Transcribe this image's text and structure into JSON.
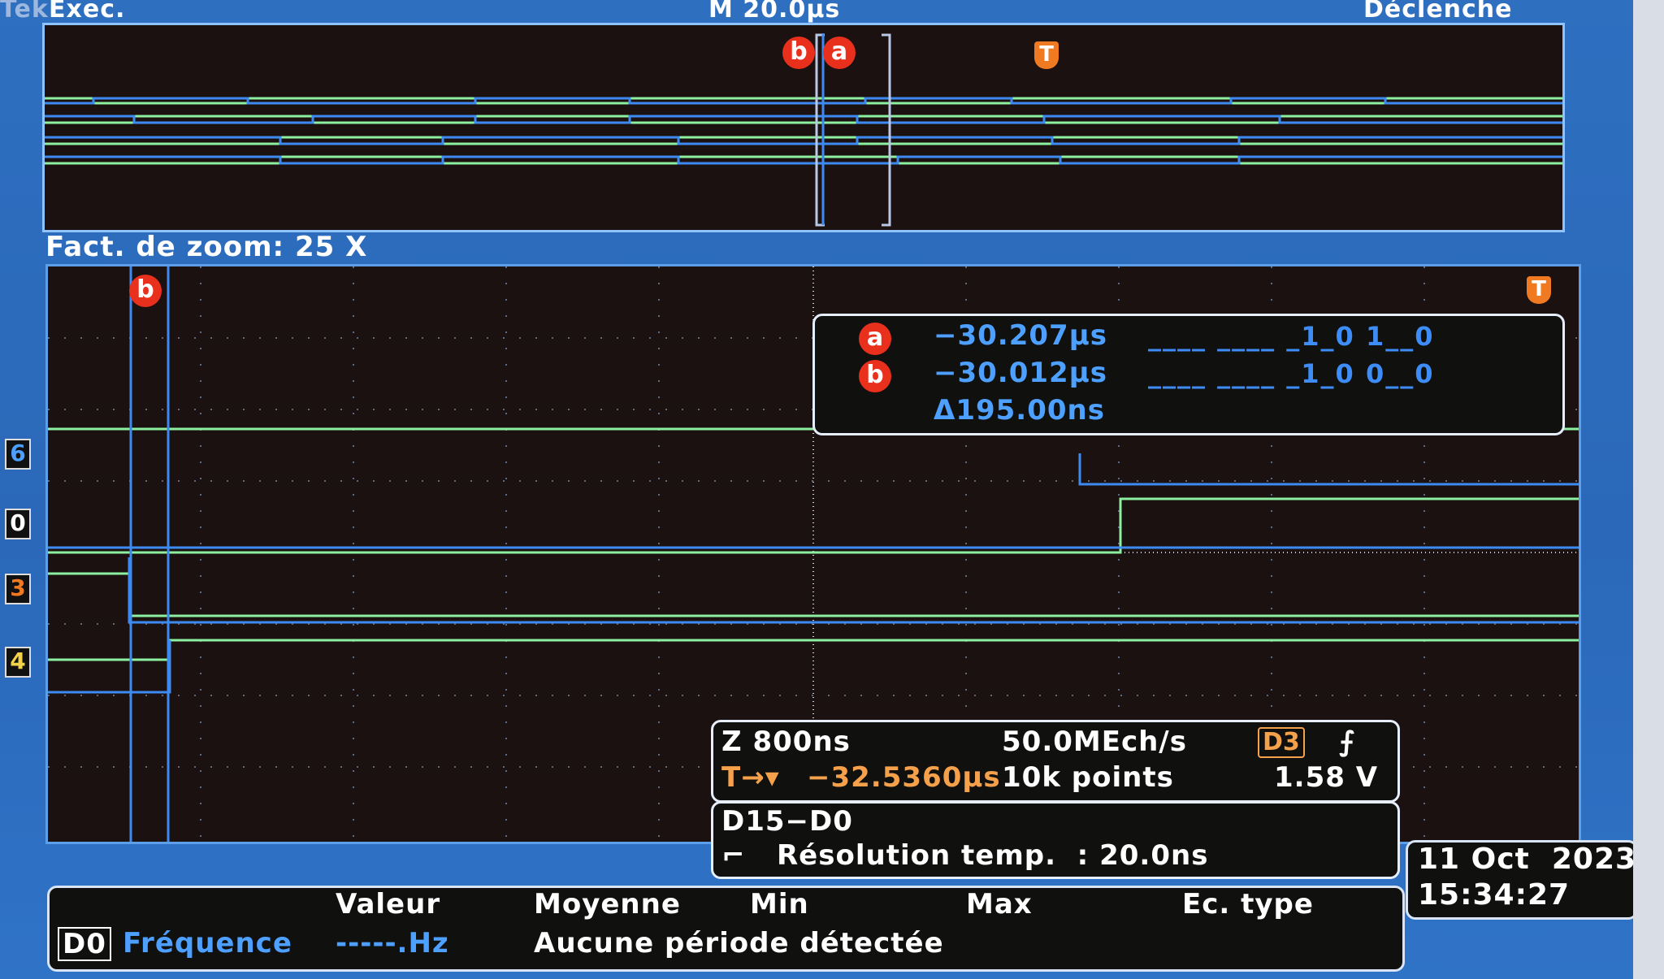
{
  "header": {
    "run_status": "Exec.",
    "timebase": "M 20.0µs",
    "trigger_mode": "Déclenche",
    "brand_fragment": "Tek"
  },
  "overview": {
    "markers": {
      "a": "a",
      "b": "b",
      "trigger": "T"
    }
  },
  "zoom": {
    "factor_label": "Fact. de zoom: 25 X",
    "cursor_b": "b",
    "trigger": "T",
    "channel_tags": [
      "6",
      "0",
      "3",
      "4"
    ]
  },
  "cursor_readout": {
    "a_label": "a",
    "a_time": "−30.207µs",
    "a_bits": "____ ____ _1_0 1__0",
    "b_label": "b",
    "b_time": "−30.012µs",
    "b_bits": "____ ____ _1_0 0__0",
    "delta": "Δ195.00ns"
  },
  "timebase_info": {
    "zoom_scale": "Z 800ns",
    "sample_rate": "50.0MEch/s",
    "trigger_source": "D3",
    "trigger_slope": "⨍",
    "trigger_position": "−32.5360µs",
    "trigger_prefix": "T→▾",
    "record_length": "10k points",
    "trigger_level": "1.58 V"
  },
  "digital_info": {
    "channels": "D15−D0",
    "resolution_label": "Résolution temp.  : 20.0ns"
  },
  "measurements": {
    "headers": [
      "Valeur",
      "Moyenne",
      "Min",
      "Max",
      "Ec. type"
    ],
    "channel": "D0",
    "name": "Fréquence",
    "value": "-----.Hz",
    "status": "Aucune période détectée"
  },
  "datetime": {
    "date": "11 Oct  2023",
    "time": "15:34:27"
  },
  "colors": {
    "trace_green": "#8df0a0",
    "trace_blue": "#3d8af2",
    "marker_red": "#e8301d",
    "trigger_orange": "#f07a21",
    "screen_blue": "#2e6fc0"
  }
}
